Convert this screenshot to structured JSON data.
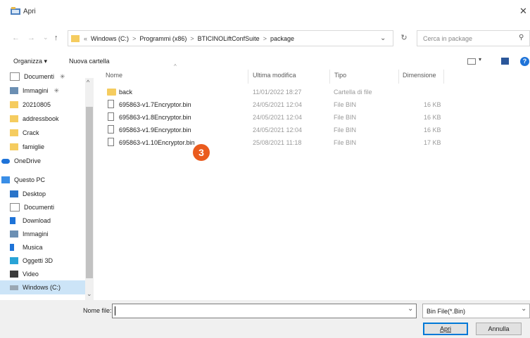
{
  "window": {
    "title": "Apri",
    "close_glyph": "✕"
  },
  "nav": {
    "back_glyph": "←",
    "forward_glyph": "→",
    "recent_glyph": "⌄",
    "up_glyph": "↑",
    "path_prefix": "«",
    "breadcrumb": [
      "Windows (C:)",
      "Programmi (x86)",
      "BTICINOLiftConfSuite",
      "package"
    ],
    "separator": ">",
    "dropdown_glyph": "⌄",
    "refresh_glyph": "↻",
    "search_placeholder": "Cerca in package",
    "search_glyph": "⚲"
  },
  "toolbar": {
    "organize": "Organizza",
    "organize_arrow": "▾",
    "new_folder": "Nuova cartella",
    "view_arrow": "▾",
    "help_glyph": "?"
  },
  "sidebar": {
    "items": [
      {
        "label": "Documenti",
        "icon": "documents-icon",
        "pin": "✳",
        "scroll_up": "^"
      },
      {
        "label": "Immagini",
        "icon": "pictures-icon",
        "pin": "✳"
      },
      {
        "label": "20210805",
        "icon": "folder-icon"
      },
      {
        "label": "addressbook",
        "icon": "folder-icon"
      },
      {
        "label": "Crack",
        "icon": "folder-icon"
      },
      {
        "label": "famiglie",
        "icon": "folder-icon"
      },
      {
        "label": "OneDrive",
        "icon": "onedrive-icon"
      },
      {
        "label": "Questo PC",
        "icon": "pc-icon"
      },
      {
        "label": "Desktop",
        "icon": "desktop-icon"
      },
      {
        "label": "Documenti",
        "icon": "documents-icon"
      },
      {
        "label": "Download",
        "icon": "download-icon"
      },
      {
        "label": "Immagini",
        "icon": "pictures-icon"
      },
      {
        "label": "Musica",
        "icon": "music-icon"
      },
      {
        "label": "Oggetti 3D",
        "icon": "objects3d-icon"
      },
      {
        "label": "Video",
        "icon": "video-icon"
      },
      {
        "label": "Windows (C:)",
        "icon": "drive-icon"
      }
    ],
    "scroll_down": "⌄"
  },
  "columns": {
    "name": "Nome",
    "modified": "Ultima modifica",
    "type": "Tipo",
    "size": "Dimensione",
    "sort_glyph": "^"
  },
  "files": [
    {
      "name": "back",
      "modified": "11/01/2022 18:27",
      "type": "Cartella di file",
      "size": "",
      "kind": "folder"
    },
    {
      "name": "695863-v1.7Encryptor.bin",
      "modified": "24/05/2021 12:04",
      "type": "File BIN",
      "size": "16 KB",
      "kind": "file"
    },
    {
      "name": "695863-v1.8Encryptor.bin",
      "modified": "24/05/2021 12:04",
      "type": "File BIN",
      "size": "16 KB",
      "kind": "file"
    },
    {
      "name": "695863-v1.9Encryptor.bin",
      "modified": "24/05/2021 12:04",
      "type": "File BIN",
      "size": "16 KB",
      "kind": "file"
    },
    {
      "name": "695863-v1.10Encryptor.bin",
      "modified": "25/08/2021 11:18",
      "type": "File BIN",
      "size": "17 KB",
      "kind": "file"
    }
  ],
  "badge": {
    "number": "3",
    "color": "#ea5b1e"
  },
  "footer": {
    "filename_label": "Nome file:",
    "filename_value": "",
    "filename_arrow": "⌄",
    "filetype": "Bin File(*.Bin)",
    "filetype_arrow": "⌄",
    "open": "Apri",
    "cancel": "Annulla"
  }
}
